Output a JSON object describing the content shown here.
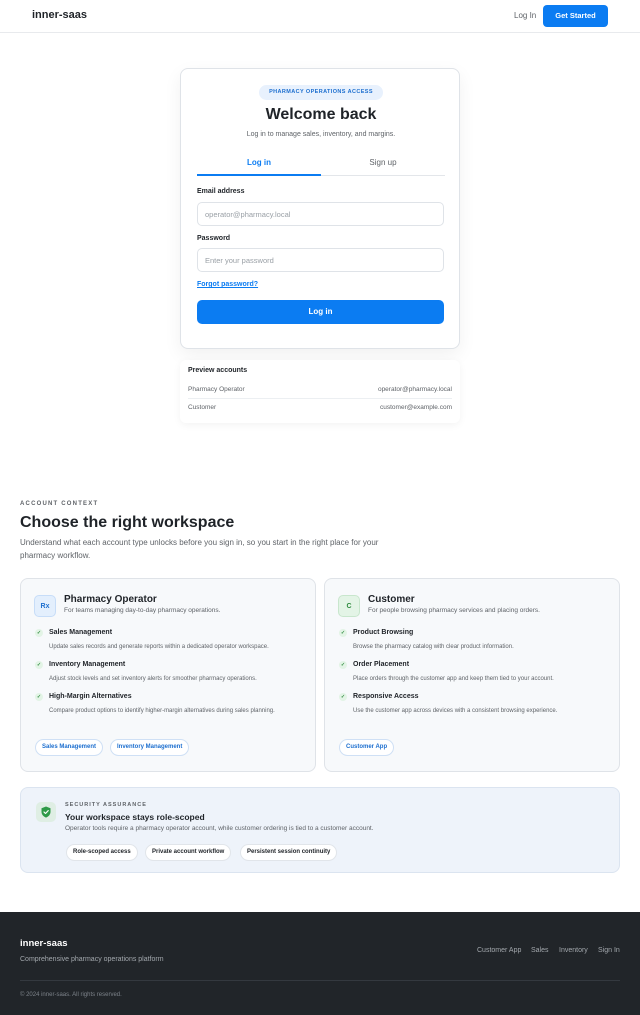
{
  "header": {
    "brand": "inner-saas",
    "login_label": "Log In",
    "cta_label": "Get Started"
  },
  "auth": {
    "badge": "PHARMACY OPERATIONS ACCESS",
    "title": "Welcome back",
    "subtitle": "Log in to manage sales, inventory, and margins.",
    "tabs": [
      "Log in",
      "Sign up"
    ],
    "active_tab": "Log in",
    "email_label": "Email address",
    "email_placeholder": "operator@pharmacy.local",
    "password_label": "Password",
    "password_placeholder": "Enter your password",
    "forgot_label": "Forgot password?",
    "submit_label": "Log in"
  },
  "preview": {
    "title": "Preview accounts",
    "accounts": [
      {
        "role": "Pharmacy Operator",
        "email": "operator@pharmacy.local"
      },
      {
        "role": "Customer",
        "email": "customer@example.com"
      }
    ]
  },
  "context": {
    "eyebrow": "ACCOUNT CONTEXT",
    "title": "Choose the right workspace",
    "description": "Understand what each account type unlocks before you sign in, so you start in the right place for your pharmacy workflow."
  },
  "roles": [
    {
      "icon_text": "Rx",
      "name": "Pharmacy Operator",
      "subtitle": "For teams managing day-to-day pharmacy operations.",
      "features": [
        {
          "name": "Sales Management",
          "desc": "Update sales records and generate reports within a dedicated operator workspace."
        },
        {
          "name": "Inventory Management",
          "desc": "Adjust stock levels and set inventory alerts for smoother pharmacy operations."
        },
        {
          "name": "High-Margin Alternatives",
          "desc": "Compare product options to identify higher-margin alternatives during sales planning."
        }
      ],
      "chips": [
        "Sales Management",
        "Inventory Management"
      ]
    },
    {
      "icon_text": "C",
      "name": "Customer",
      "subtitle": "For people browsing pharmacy services and placing orders.",
      "features": [
        {
          "name": "Product Browsing",
          "desc": "Browse the pharmacy catalog with clear product information."
        },
        {
          "name": "Order Placement",
          "desc": "Place orders through the customer app and keep them tied to your account."
        },
        {
          "name": "Responsive Access",
          "desc": "Use the customer app across devices with a consistent browsing experience."
        }
      ],
      "chips": [
        "Customer App"
      ]
    }
  ],
  "security": {
    "eyebrow": "SECURITY ASSURANCE",
    "title": "Your workspace stays role-scoped",
    "description": "Operator tools require a pharmacy operator account, while customer ordering is tied to a customer account.",
    "pills": [
      "Role-scoped access",
      "Private account workflow",
      "Persistent session continuity"
    ],
    "icon": "shield-check-icon",
    "accent": "#2e9a48"
  },
  "footer": {
    "brand": "inner-saas",
    "tagline": "Comprehensive pharmacy operations platform",
    "links": [
      "Customer App",
      "Sales",
      "Inventory",
      "Sign In"
    ],
    "copyright": "© 2024 inner-saas. All rights reserved."
  },
  "colors": {
    "primary": "#0b7cf2",
    "footer_bg": "#212529"
  }
}
